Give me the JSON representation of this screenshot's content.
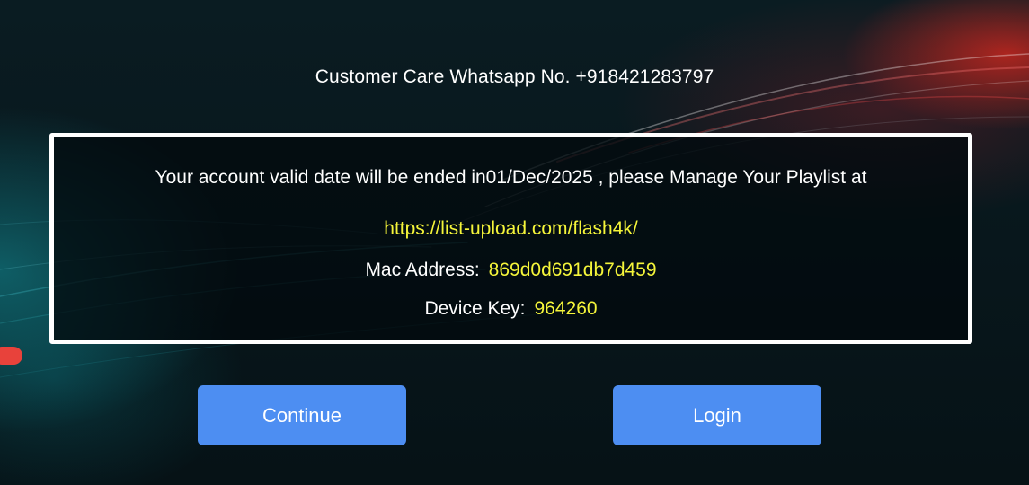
{
  "header": {
    "customer_care": "Customer Care Whatsapp No. +918421283797"
  },
  "panel": {
    "validity_message": "Your account valid date will be ended in01/Dec/2025 , please Manage Your Playlist at",
    "playlist_url": "https://list-upload.com/flash4k/",
    "mac_label": "Mac Address:",
    "mac_value": "869d0d691db7d459",
    "device_key_label": "Device Key:",
    "device_key_value": "964260"
  },
  "buttons": {
    "continue_label": "Continue",
    "login_label": "Login"
  },
  "colors": {
    "accent_button": "#4d8ef2",
    "highlight_text": "#f5f53a",
    "panel_border": "#ffffff",
    "indicator": "#e8423b"
  }
}
